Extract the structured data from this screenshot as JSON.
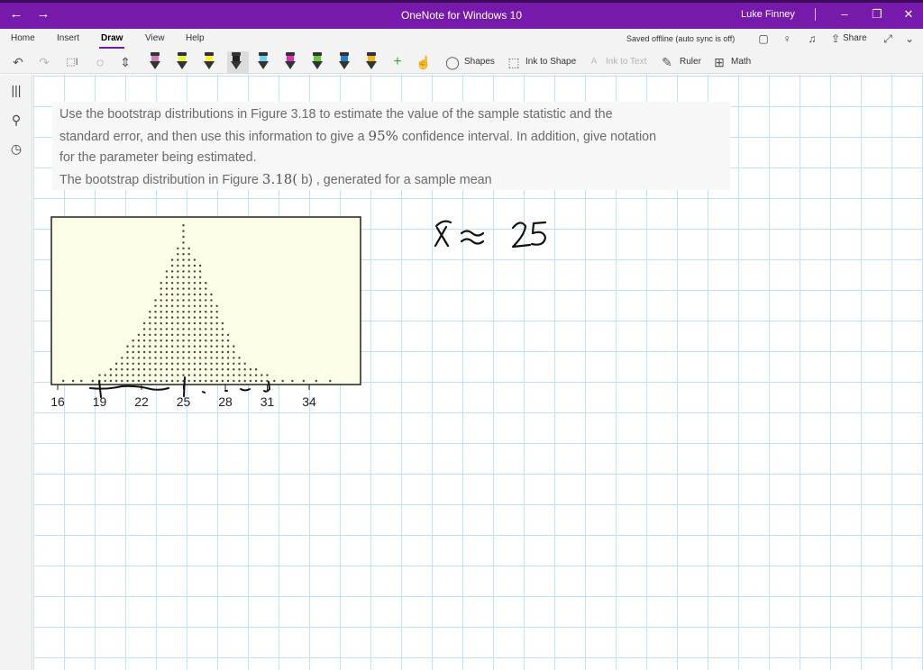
{
  "window": {
    "title": "OneNote for Windows 10",
    "user": "Luke Finney",
    "back_icon": "arrow-left-icon",
    "forward_icon": "arrow-right-icon",
    "minimize_icon": "minimize-icon",
    "restore_icon": "restore-icon",
    "close_icon": "close-icon",
    "accent_color": "#7719aa"
  },
  "ribbon": {
    "tabs": [
      "Home",
      "Insert",
      "Draw",
      "View",
      "Help"
    ],
    "active_tab": "Draw",
    "sync_status": "Saved offline (auto sync is off)",
    "share_label": "Share"
  },
  "toolbar": {
    "shapes_label": "Shapes",
    "ink_to_shape_label": "Ink to Shape",
    "ink_to_text_label": "Ink to Text",
    "ruler_label": "Ruler",
    "math_label": "Math",
    "pens": [
      {
        "name": "pen",
        "color": "#d67bb4"
      },
      {
        "name": "pen",
        "color": "#e6f43a"
      },
      {
        "name": "highlighter",
        "color": "#ffef3a"
      },
      {
        "name": "pen",
        "color": "#222222"
      },
      {
        "name": "highlighter",
        "color": "#6ad4f2"
      },
      {
        "name": "pen",
        "color": "#e02fb5"
      },
      {
        "name": "pen",
        "color": "#63c93b"
      },
      {
        "name": "pen",
        "color": "#1f7fd1"
      },
      {
        "name": "pen",
        "color": "#f3b21d"
      }
    ]
  },
  "problem": {
    "line1": "Use the bootstrap distributions in Figure 3.18 to estimate the value of the sample statistic and the",
    "line2_a": "standard error, and then use this information to give a ",
    "line2_b": "95%",
    "line2_c": " confidence interval. In addition, give notation",
    "line3": "for the parameter being estimated.",
    "line4_a": "The bootstrap distribution in Figure ",
    "line4_b": "3.18(",
    "line4_c": " b) ",
    "line4_d": ", generated for a sample mean"
  },
  "chart_data": {
    "type": "scatter",
    "title": "",
    "xlabel": "",
    "ylabel": "",
    "xlim": [
      15.5,
      37.5
    ],
    "x_ticks": [
      16,
      19,
      22,
      25,
      28,
      31,
      34
    ],
    "dot_counts": [
      [
        16.4,
        1
      ],
      [
        17.1,
        1
      ],
      [
        17.7,
        1
      ],
      [
        18.5,
        1
      ],
      [
        19.0,
        2
      ],
      [
        19.4,
        2
      ],
      [
        19.8,
        3
      ],
      [
        20.2,
        4
      ],
      [
        20.6,
        5
      ],
      [
        21.0,
        7
      ],
      [
        21.4,
        8
      ],
      [
        21.8,
        9
      ],
      [
        22.2,
        11
      ],
      [
        22.6,
        13
      ],
      [
        23.0,
        15
      ],
      [
        23.4,
        18
      ],
      [
        23.8,
        20
      ],
      [
        24.2,
        22
      ],
      [
        24.6,
        24
      ],
      [
        25.0,
        28
      ],
      [
        25.4,
        24
      ],
      [
        25.8,
        22
      ],
      [
        26.2,
        21
      ],
      [
        26.6,
        18
      ],
      [
        27.0,
        16
      ],
      [
        27.4,
        14
      ],
      [
        27.8,
        11
      ],
      [
        28.2,
        9
      ],
      [
        28.6,
        7
      ],
      [
        29.0,
        5
      ],
      [
        29.4,
        4
      ],
      [
        29.8,
        3
      ],
      [
        30.2,
        3
      ],
      [
        30.6,
        2
      ],
      [
        31.0,
        2
      ],
      [
        31.5,
        1
      ],
      [
        32.1,
        1
      ],
      [
        32.8,
        1
      ],
      [
        33.6,
        1
      ],
      [
        34.5,
        1
      ],
      [
        35.5,
        1
      ]
    ],
    "background_color": "#fcfde6",
    "dot_color": "#444444"
  },
  "ink": {
    "estimate": "x̄ ≈ 25",
    "interval_marks": [
      19,
      25,
      31
    ]
  }
}
